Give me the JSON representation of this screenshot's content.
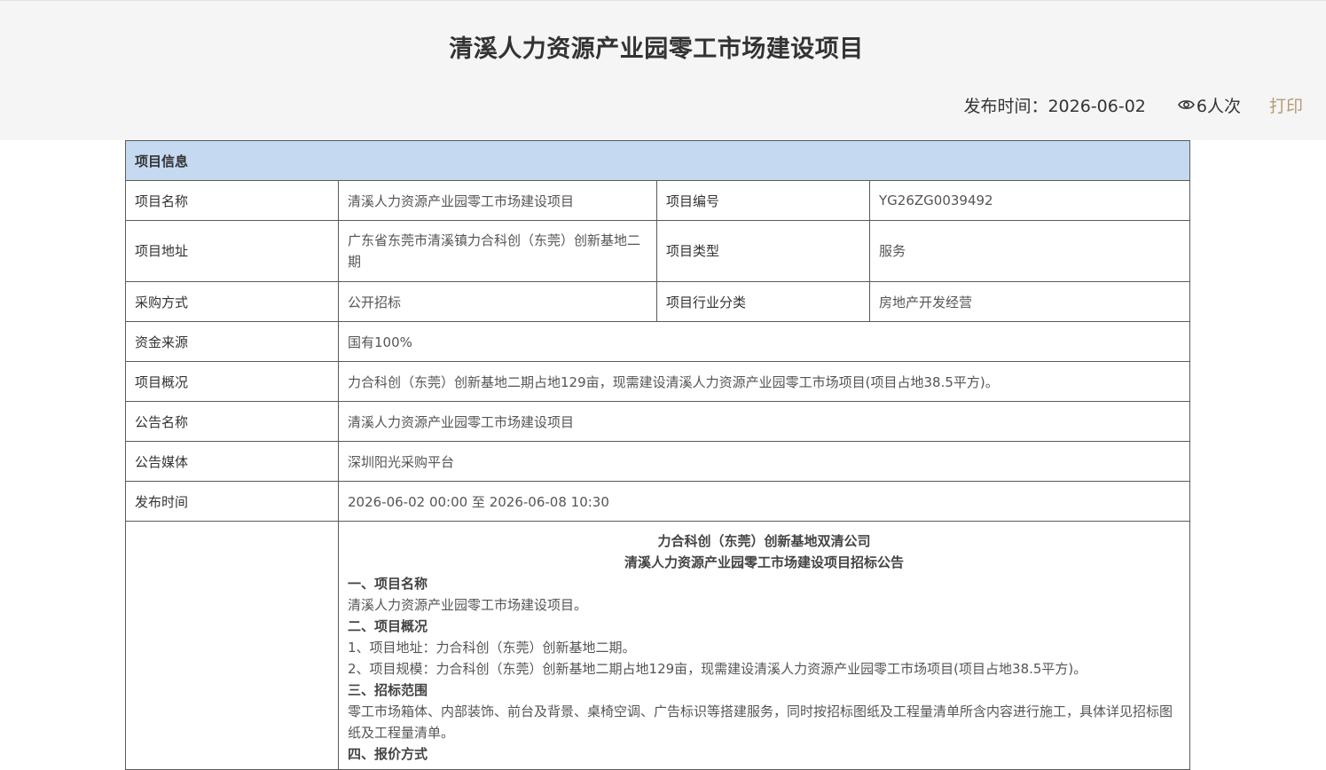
{
  "header": {
    "title": "清溪人力资源产业园零工市场建设项目",
    "publish_label": "发布时间：2026-06-02",
    "views_label": "6人次",
    "print_label": "打印",
    "icons": {
      "views": "eye-icon"
    }
  },
  "colors": {
    "header_bg": "#f5f5f5",
    "section_head_bg": "#c5d9f1",
    "print_link": "#b89a72",
    "border": "#5a5a5a"
  },
  "section": {
    "title": "项目信息"
  },
  "rows": {
    "project_name": {
      "label": "项目名称",
      "value": "清溪人力资源产业园零工市场建设项目"
    },
    "project_no": {
      "label": "项目编号",
      "value": "YG26ZG0039492"
    },
    "project_address": {
      "label": "项目地址",
      "value": "广东省东莞市清溪镇力合科创（东莞）创新基地二期"
    },
    "project_type": {
      "label": "项目类型",
      "value": "服务"
    },
    "purchase_method": {
      "label": "采购方式",
      "value": "公开招标"
    },
    "industry": {
      "label": "项目行业分类",
      "value": "房地产开发经营"
    },
    "fund_source": {
      "label": "资金来源",
      "value": "国有100%"
    },
    "overview": {
      "label": "项目概况",
      "value": "力合科创（东莞）创新基地二期占地129亩，现需建设清溪人力资源产业园零工市场项目(项目占地38.5平方)。"
    },
    "notice_name": {
      "label": "公告名称",
      "value": "清溪人力资源产业园零工市场建设项目"
    },
    "notice_media": {
      "label": "公告媒体",
      "value": "深圳阳光采购平台"
    },
    "publish_time": {
      "label": "发布时间",
      "value": "2026-06-02 00:00 至 2026-06-08 10:30"
    }
  },
  "notice": {
    "title_line1": "力合科创（东莞）创新基地双清公司",
    "title_line2": "清溪人力资源产业园零工市场建设项目招标公告",
    "h1": "一、项目名称",
    "p1": "清溪人力资源产业园零工市场建设项目。",
    "h2": "二、项目概况",
    "p2_1": "1、项目地址：力合科创（东莞）创新基地二期。",
    "p2_2": "2、项目规模：力合科创（东莞）创新基地二期占地129亩，现需建设清溪人力资源产业园零工市场项目(项目占地38.5平方)。",
    "h3": "三、招标范围",
    "p3": "零工市场箱体、内部装饰、前台及背景、桌椅空调、广告标识等搭建服务，同时按招标图纸及工程量清单所含内容进行施工，具体详见招标图纸及工程量清单。",
    "h4": "四、报价方式"
  }
}
